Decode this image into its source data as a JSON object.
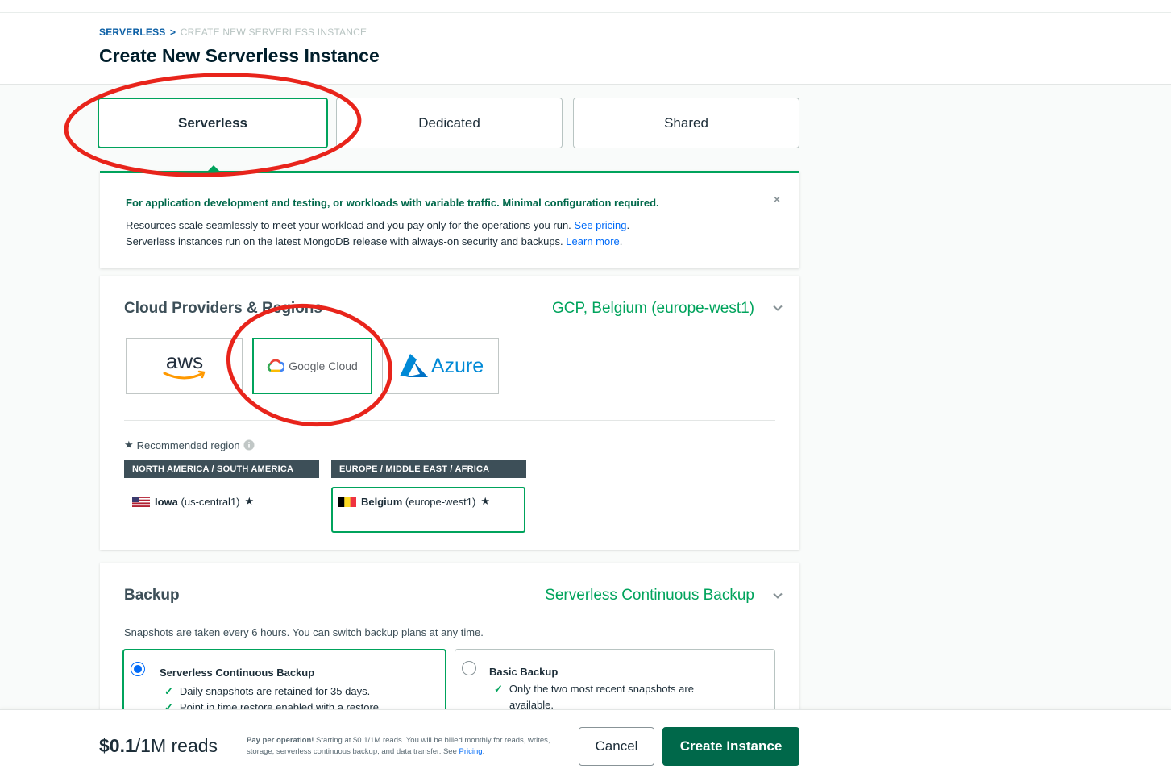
{
  "breadcrumb": {
    "root": "SERVERLESS",
    "separator": ">",
    "current": "CREATE NEW SERVERLESS INSTANCE"
  },
  "page_title": "Create New Serverless Instance",
  "tabs": [
    {
      "label": "Serverless",
      "active": true
    },
    {
      "label": "Dedicated",
      "active": false
    },
    {
      "label": "Shared",
      "active": false
    }
  ],
  "info": {
    "headline": "For application development and testing, or workloads with variable traffic. Minimal configuration required.",
    "line1": "Resources scale seamlessly to meet your workload and you pay only for the operations you run.",
    "line1_link": "See pricing",
    "line2": "Serverless instances run on the latest MongoDB release with always-on security and backups.",
    "line2_link": "Learn more",
    "close": "×"
  },
  "cloud": {
    "title": "Cloud Providers & Regions",
    "summary": "GCP, Belgium (europe-west1)",
    "providers": [
      {
        "label": "aws",
        "selected": false
      },
      {
        "label": "Google Cloud",
        "selected": true
      },
      {
        "label": "Azure",
        "selected": false
      }
    ],
    "recommended_label": "Recommended region",
    "region_groups": [
      {
        "header": "NORTH AMERICA / SOUTH AMERICA",
        "region_name": "Iowa",
        "region_code": "(us-central1)",
        "selected": false
      },
      {
        "header": "EUROPE / MIDDLE EAST / AFRICA",
        "region_name": "Belgium",
        "region_code": "(europe-west1)",
        "selected": true
      }
    ]
  },
  "backup": {
    "title": "Backup",
    "summary": "Serverless Continuous Backup",
    "description": "Snapshots are taken every 6 hours. You can switch backup plans at any time.",
    "plans": [
      {
        "title": "Serverless Continuous Backup",
        "selected": true,
        "lines": [
          "Daily snapshots are retained for 35 days.",
          "Point in time restore enabled with a restore"
        ]
      },
      {
        "title": "Basic Backup",
        "selected": false,
        "lines": [
          "Only the two most recent snapshots are",
          "available."
        ]
      }
    ]
  },
  "footer": {
    "price_amount": "$0.1",
    "price_unit": "/1M reads",
    "note_bold": "Pay per operation!",
    "note_text": " Starting at $0.1/1M reads. You will be billed monthly for reads, writes, storage, serverless continuous backup, and data transfer. See ",
    "note_link": "Pricing",
    "note_end": ".",
    "cancel_label": "Cancel",
    "create_label": "Create Instance"
  },
  "colors": {
    "accent_green": "#00a35c",
    "dark_green": "#00684a",
    "link_blue": "#016bf8",
    "annotation_red": "#e8241b"
  }
}
